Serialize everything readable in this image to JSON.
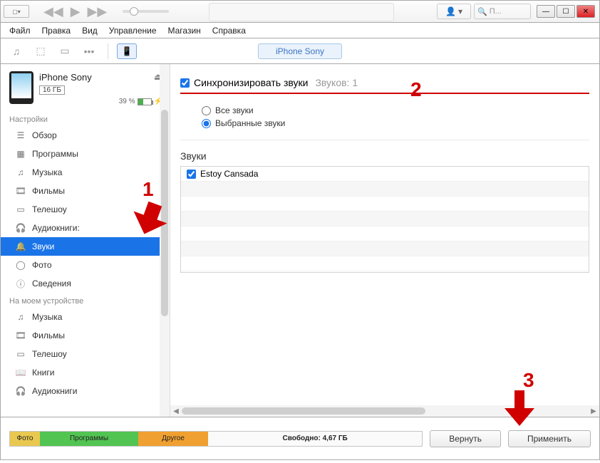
{
  "menubar": [
    "Файл",
    "Правка",
    "Вид",
    "Управление",
    "Магазин",
    "Справка"
  ],
  "search_placeholder": "П...",
  "device_tab": "iPhone Sony",
  "device": {
    "name": "iPhone Sony",
    "storage": "16 ГБ",
    "battery_pct": "39 %"
  },
  "sidebar": {
    "settings_label": "Настройки",
    "settings": [
      "Обзор",
      "Программы",
      "Музыка",
      "Фильмы",
      "Телешоу",
      "Аудиокниги:",
      "Звуки",
      "Фото",
      "Сведения"
    ],
    "ondevice_label": "На моем устройстве",
    "ondevice": [
      "Музыка",
      "Фильмы",
      "Телешоу",
      "Книги",
      "Аудиокниги"
    ]
  },
  "sync": {
    "label": "Синхронизировать звуки",
    "count_label": "Звуков:",
    "count": "1",
    "radio_all": "Все звуки",
    "radio_selected": "Выбранные звуки"
  },
  "sounds": {
    "title": "Звуки",
    "items": [
      "Estoy Cansada"
    ]
  },
  "storage": {
    "photo": "Фото",
    "apps": "Программы",
    "other": "Другое",
    "free": "Свободно: 4,67 ГБ"
  },
  "buttons": {
    "revert": "Вернуть",
    "apply": "Применить"
  },
  "annotations": {
    "a1": "1",
    "a2": "2",
    "a3": "3"
  }
}
